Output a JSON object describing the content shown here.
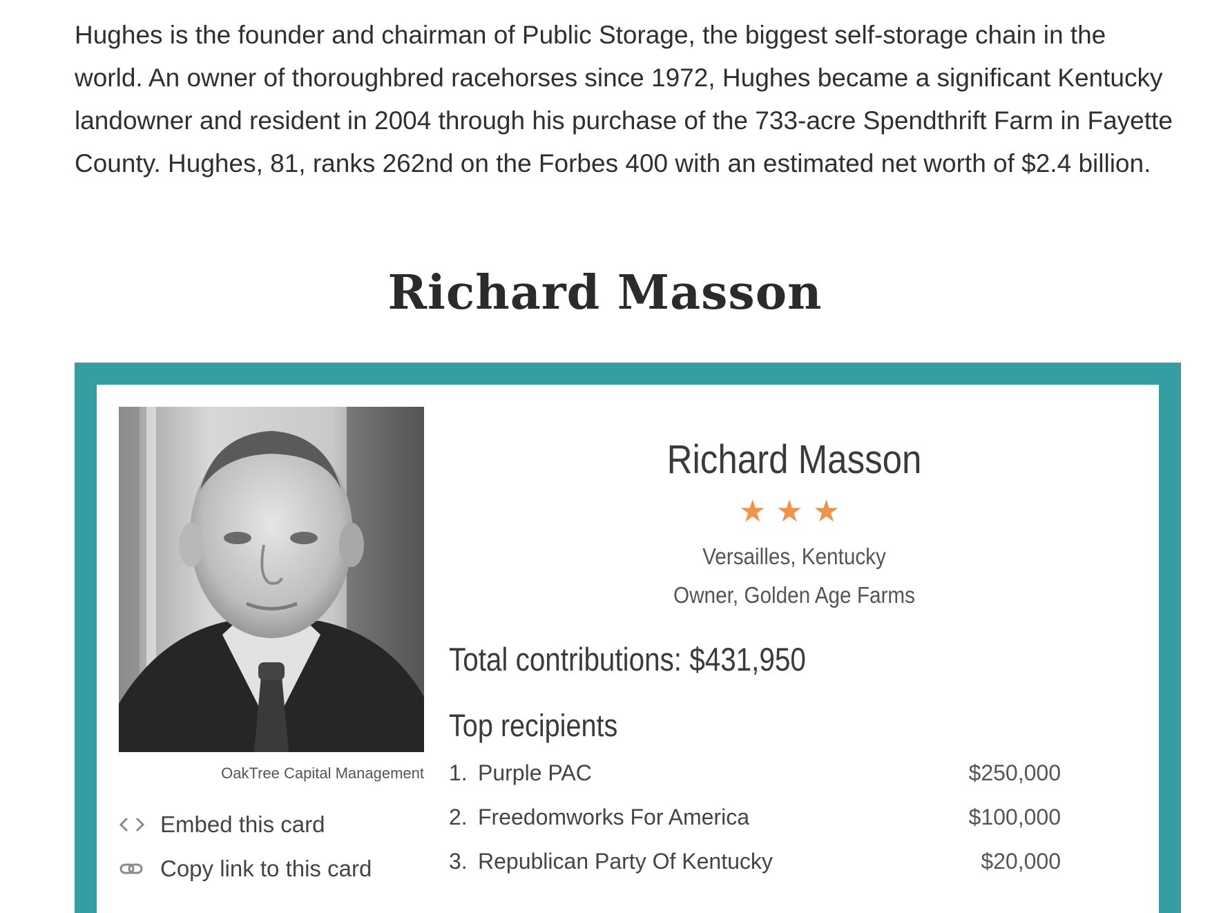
{
  "intro": {
    "paragraph": "Hughes is the founder and chairman of Public Storage, the biggest self-storage chain in the world. An owner of thoroughbred racehorses since 1972, Hughes became a significant Kentucky landowner and resident in 2004 through his purchase of the 733-acre Spendthrift Farm in Fayette County. Hughes, 81, ranks 262nd on the Forbes 400 with an estimated net worth of $2.4 billion."
  },
  "section": {
    "heading": "Richard Masson"
  },
  "card": {
    "frame_color": "#349ea3",
    "photo_credit": "OakTree Capital Management",
    "name": "Richard Masson",
    "stars": "★★★",
    "star_color": "#f0944a",
    "location": "Versailles, Kentucky",
    "occupation": "Owner, Golden Age Farms",
    "total_label": "Total contributions: $431,950",
    "recipients_heading": "Top recipients",
    "recipients": [
      {
        "num": "1.",
        "name": "Purple PAC",
        "amount": "$250,000"
      },
      {
        "num": "2.",
        "name": "Freedomworks For America",
        "amount": "$100,000"
      },
      {
        "num": "3.",
        "name": "Republican Party Of Kentucky",
        "amount": "$20,000"
      }
    ],
    "actions": {
      "embed_label": "Embed this card",
      "embed_icon": "code-icon",
      "copy_label": "Copy link to this card",
      "copy_icon": "link-icon"
    }
  }
}
